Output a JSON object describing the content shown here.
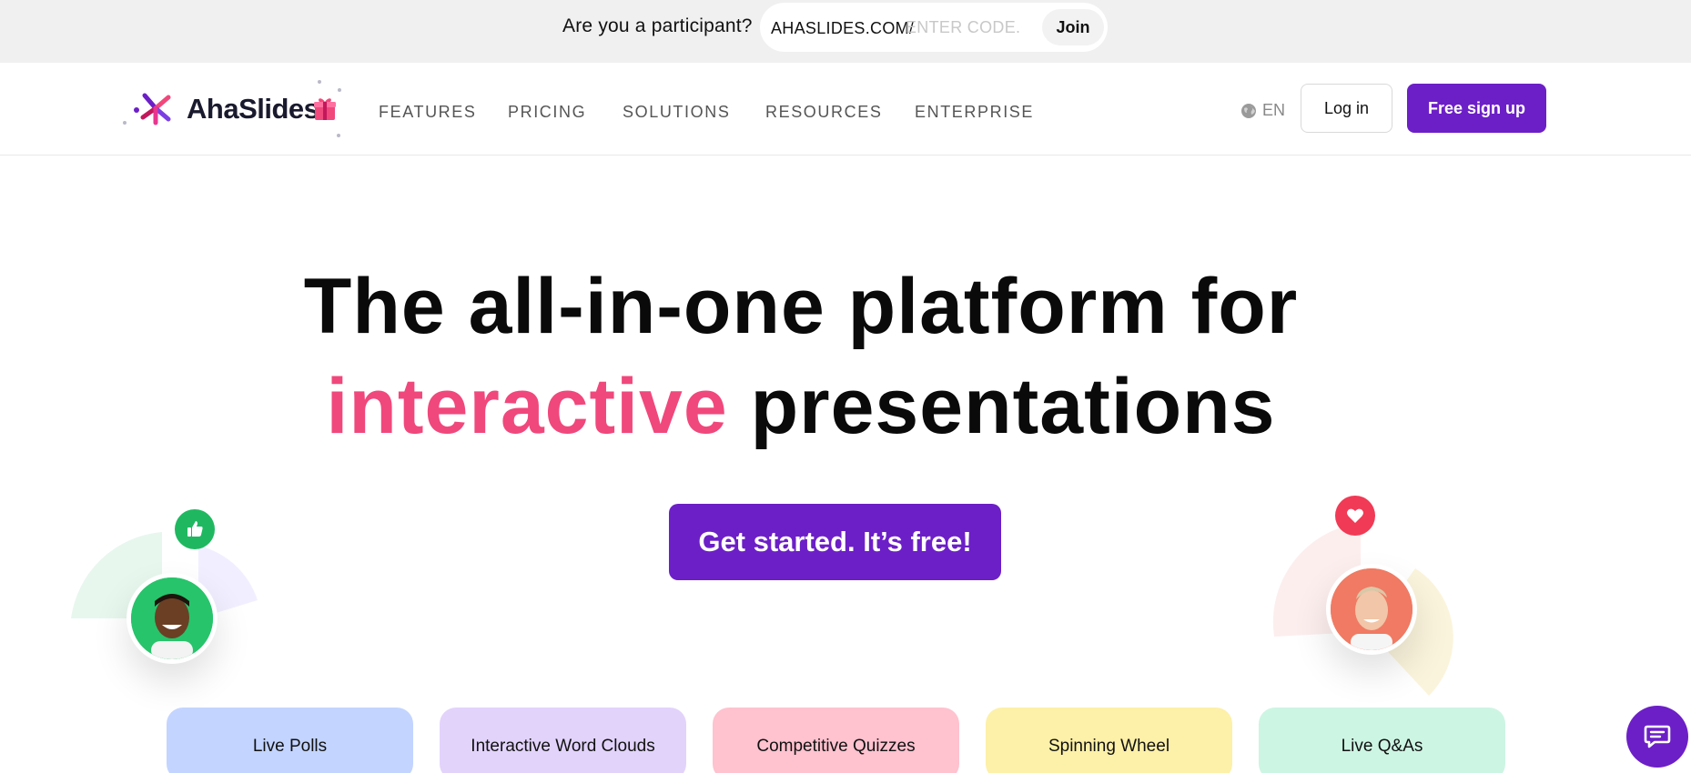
{
  "participant_bar": {
    "question": "Are you a participant?",
    "code_prefix": "AHASLIDES.COM/",
    "code_placeholder": "ENTER CODE.",
    "code_value": "",
    "join_label": "Join"
  },
  "header": {
    "brand": "AhaSlides",
    "logo_icon": "ahaslides-logo-icon",
    "gift_icon": "gift-icon",
    "nav": [
      {
        "label": "FEATURES"
      },
      {
        "label": "PRICING"
      },
      {
        "label": "SOLUTIONS"
      },
      {
        "label": "RESOURCES"
      },
      {
        "label": "ENTERPRISE"
      }
    ],
    "language": "EN",
    "language_icon": "globe-icon",
    "login_label": "Log in",
    "signup_label": "Free sign up"
  },
  "hero": {
    "line1": "The all-in-one platform for",
    "line2_highlight": "interactive",
    "line2_rest": "presentations",
    "cta_label": "Get started. It’s free!"
  },
  "decorations": {
    "left_reaction_icon": "thumbs-up-icon",
    "right_reaction_icon": "heart-icon"
  },
  "feature_cards": [
    {
      "label": "Live Polls",
      "color": "#c3d4ff"
    },
    {
      "label": "Interactive Word Clouds",
      "color": "#e2d3fb"
    },
    {
      "label": "Competitive Quizzes",
      "color": "#ffc2cf"
    },
    {
      "label": "Spinning Wheel",
      "color": "#fdf0a8"
    },
    {
      "label": "Live Q&As",
      "color": "#cdf5e3"
    }
  ],
  "chat_icon": "chat-icon",
  "colors": {
    "brand_purple": "#6c1fc7",
    "accent_pink": "#f0487c",
    "topbar_bg": "#f0f0f0"
  }
}
